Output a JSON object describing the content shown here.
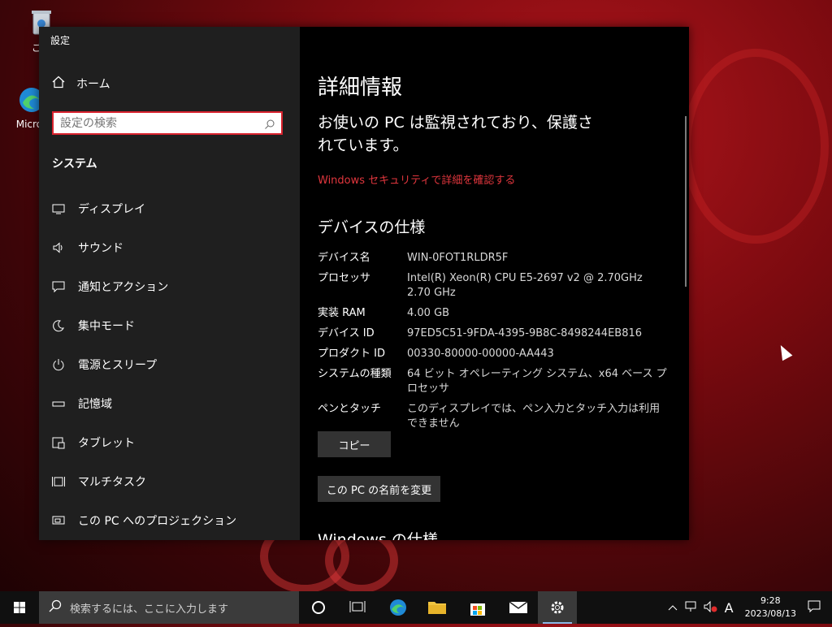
{
  "desktop": {
    "icons": [
      {
        "label": "ごみ"
      },
      {
        "label": "Micros"
      }
    ]
  },
  "window": {
    "title": "設定",
    "controls": {
      "minimize": "─",
      "close": "✕"
    }
  },
  "sidebar": {
    "home_label": "ホーム",
    "search_placeholder": "設定の検索",
    "section_title": "システム",
    "items": [
      {
        "label": "ディスプレイ",
        "icon": "display-icon"
      },
      {
        "label": "サウンド",
        "icon": "speaker-icon"
      },
      {
        "label": "通知とアクション",
        "icon": "notification-icon"
      },
      {
        "label": "集中モード",
        "icon": "moon-icon"
      },
      {
        "label": "電源とスリープ",
        "icon": "power-icon"
      },
      {
        "label": "記憶域",
        "icon": "storage-icon"
      },
      {
        "label": "タブレット",
        "icon": "tablet-icon"
      },
      {
        "label": "マルチタスク",
        "icon": "multitask-icon"
      },
      {
        "label": "この PC へのプロジェクション",
        "icon": "projection-icon"
      }
    ]
  },
  "main": {
    "heading": "詳細情報",
    "protection_text": "お使いの PC は監視されており、保護されています。",
    "security_link": "Windows セキュリティで詳細を確認する",
    "device_spec_heading": "デバイスの仕様",
    "specs": [
      {
        "label": "デバイス名",
        "value": "WIN-0FOT1RLDR5F"
      },
      {
        "label": "プロセッサ",
        "value": "Intel(R) Xeon(R) CPU E5-2697 v2 @ 2.70GHz   2.70 GHz"
      },
      {
        "label": "実装 RAM",
        "value": "4.00 GB"
      },
      {
        "label": "デバイス ID",
        "value": "97ED5C51-9FDA-4395-9B8C-8498244EB816"
      },
      {
        "label": "プロダクト ID",
        "value": "00330-80000-00000-AA443"
      },
      {
        "label": "システムの種類",
        "value": "64 ビット オペレーティング システム、x64 ベース プロセッサ"
      },
      {
        "label": "ペンとタッチ",
        "value": "このディスプレイでは、ペン入力とタッチ入力は利用できません"
      }
    ],
    "copy_button": "コピー",
    "rename_button": "この PC の名前を変更",
    "windows_spec_heading": "Windows の仕様"
  },
  "taskbar": {
    "search_placeholder": "検索するには、ここに入力します",
    "ime": "A",
    "time": "9:28",
    "date": "2023/08/13"
  },
  "colors": {
    "accent_red": "#d9232e",
    "link_red": "#e0363d",
    "sidebar_bg": "#1f1f1f",
    "content_bg": "#000000",
    "taskbar_bg": "#101010"
  }
}
